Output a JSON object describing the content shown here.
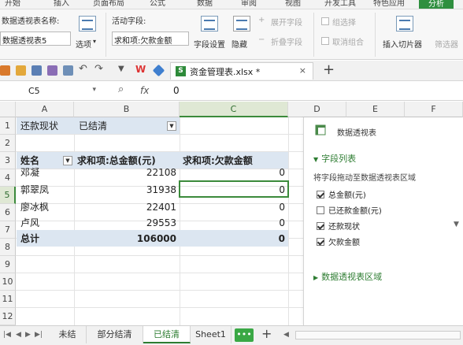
{
  "ribbon_tabs": [
    "开始",
    "插入",
    "页面布局",
    "公式",
    "数据",
    "审阅",
    "视图",
    "开发工具",
    "特色应用",
    "分析"
  ],
  "ribbon": {
    "pivot_name_label": "数据透视表名称:",
    "pivot_name_value": "数据透视表5",
    "options_label": "选项",
    "active_field_label": "活动字段:",
    "active_field_value": "求和项:欠款金额",
    "field_settings": "字段设置",
    "hide": "隐藏",
    "expand_field": "展开字段",
    "collapse_field": "折叠字段",
    "group_selection": "组选择",
    "ungroup": "取消组合",
    "insert_slicer": "插入切片器",
    "filter_conn": "筛选器"
  },
  "document": {
    "name": "资金管理表.xlsx *"
  },
  "formula_bar": {
    "cell_ref": "C5",
    "fx": "fx",
    "value": "0"
  },
  "columns": [
    "A",
    "B",
    "C",
    "D",
    "E",
    "F"
  ],
  "rows": [
    "1",
    "2",
    "3",
    "4",
    "5",
    "6",
    "7",
    "8",
    "9",
    "10",
    "11",
    "12"
  ],
  "cells": {
    "a1": "还款现状",
    "b1": "已结清",
    "a3": "姓名",
    "b3": "求和项:总金额(元)",
    "c3": "求和项:欠款金额",
    "data": [
      {
        "name": "邓凝",
        "total": "22108",
        "owed": "0"
      },
      {
        "name": "郭翠凤",
        "total": "31938",
        "owed": "0"
      },
      {
        "name": "廖冰枫",
        "total": "22401",
        "owed": "0"
      },
      {
        "name": "卢风",
        "total": "29553",
        "owed": "0"
      }
    ],
    "total_label": "总计",
    "total_sum": "106000",
    "total_owed": "0"
  },
  "pivot_pane": {
    "title": "数据透视表",
    "field_list_label": "字段列表",
    "hint": "将字段拖动至数据透视表区域",
    "fields": [
      {
        "label": "总金额(元)",
        "checked": true
      },
      {
        "label": "已还款金额(元)",
        "checked": false
      },
      {
        "label": "还款现状",
        "checked": true
      },
      {
        "label": "欠款金额",
        "checked": true
      }
    ],
    "areas_label": "数据透视表区域"
  },
  "sheets": [
    "未结",
    "部分结清",
    "已结清",
    "Sheet1"
  ],
  "active_sheet": "已结清",
  "more_label": "•••",
  "colors": {
    "accent": "#2e7d32",
    "header_band": "#dce6f1",
    "excel_green": "#2e8b3a"
  }
}
